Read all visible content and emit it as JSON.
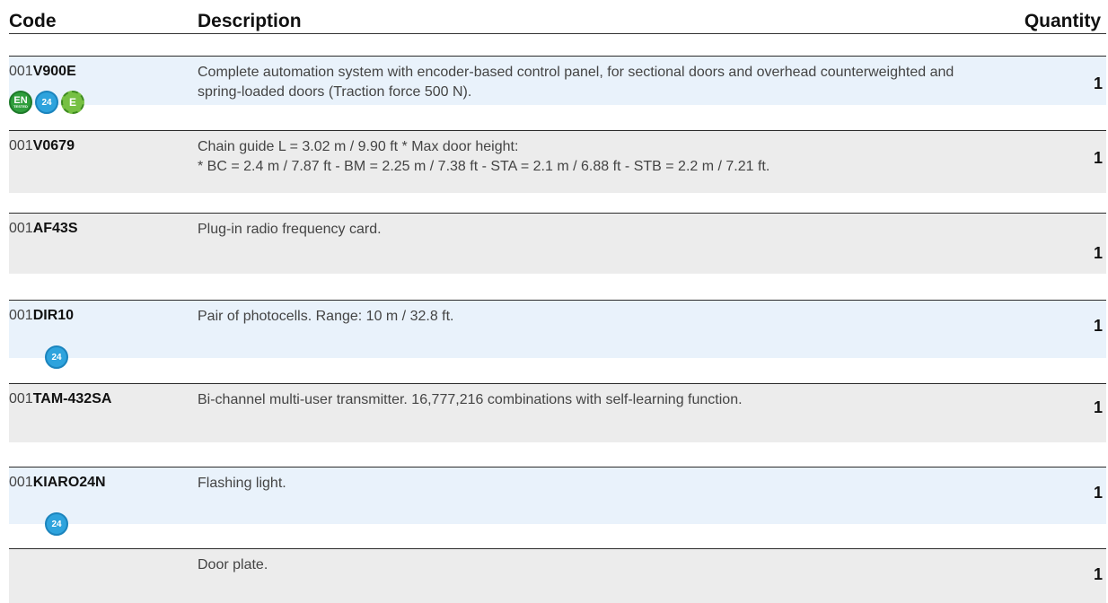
{
  "header": {
    "code": "Code",
    "description": "Description",
    "quantity": "Quantity"
  },
  "rows": [
    {
      "prefix": "001",
      "code": "V900E",
      "description": "Complete automation system with encoder-based control panel, for sectional doors and overhead counterweighted and spring-loaded doors (Traction force 500 N).",
      "quantity": "1",
      "badges": [
        "EN",
        "24",
        "E"
      ]
    },
    {
      "prefix": "001",
      "code": "V0679",
      "description_line1": "Chain guide L = 3.02 m / 9.90 ft * Max door height:",
      "description_line2": "* BC = 2.4 m / 7.87 ft - BM = 2.25 m / 7.38 ft - STA = 2.1 m / 6.88 ft - STB = 2.2 m / 7.21 ft.",
      "quantity": "1"
    },
    {
      "prefix": "001",
      "code": "AF43S",
      "description": "Plug-in radio frequency card.",
      "quantity": "1"
    },
    {
      "prefix": "001",
      "code": "DIR10",
      "description": "Pair of photocells. Range: 10 m / 32.8 ft.",
      "quantity": "1",
      "badges": [
        "24"
      ]
    },
    {
      "prefix": "001",
      "code": "TAM-432SA",
      "description": "Bi-channel multi-user transmitter. 16,777,216 combinations with self-learning function.",
      "quantity": "1"
    },
    {
      "prefix": "001",
      "code": "KIARO24N",
      "description": "Flashing light.",
      "quantity": "1",
      "badges": [
        "24"
      ]
    },
    {
      "prefix": "",
      "code": "",
      "description": "Door plate.",
      "quantity": "1"
    }
  ],
  "badge_text": {
    "en": "EN",
    "en_sub": "TESTED",
    "volt": "24",
    "energy": "E"
  },
  "colors": {
    "row_blue": "#e9f2fb",
    "row_gray": "#ececec",
    "badge_green": "#2f9e3c",
    "badge_blue": "#2ea3dd",
    "badge_lime": "#76c043"
  }
}
